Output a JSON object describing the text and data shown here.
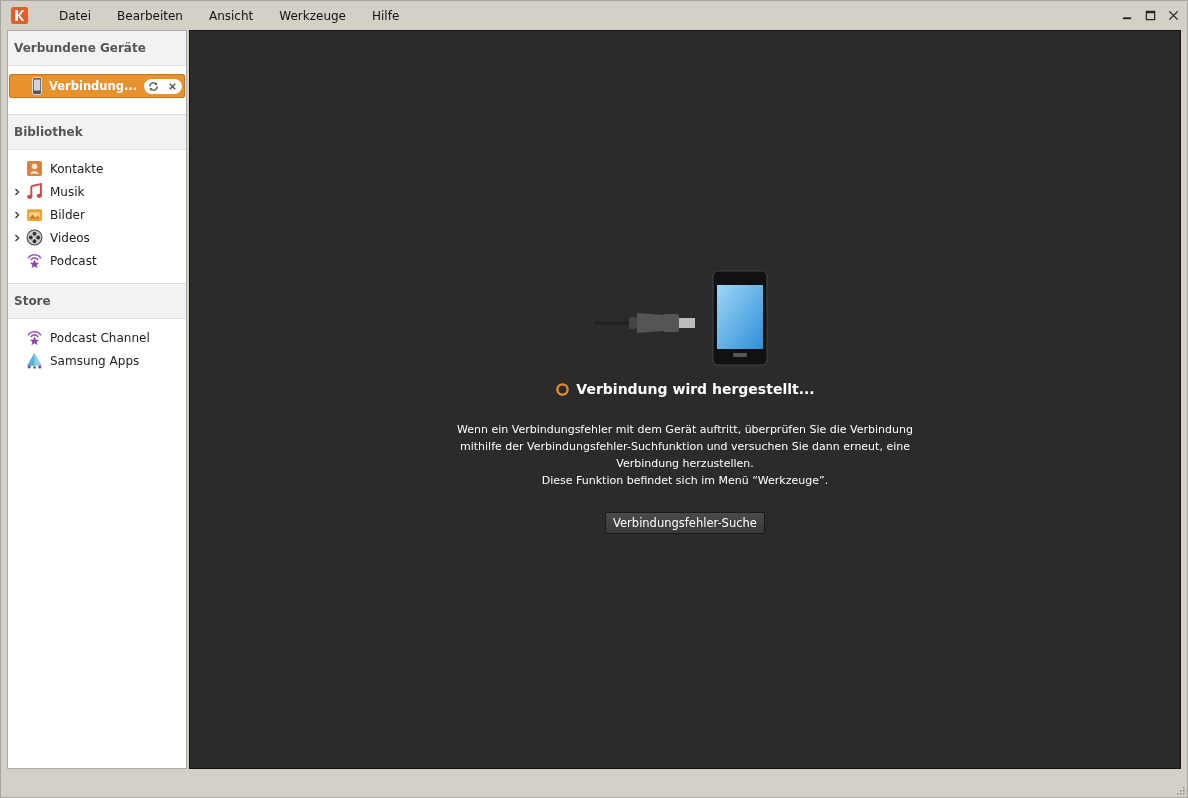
{
  "menu": [
    "Datei",
    "Bearbeiten",
    "Ansicht",
    "Werkzeuge",
    "Hilfe"
  ],
  "sidebar": {
    "sections": [
      {
        "title": "Verbundene Geräte",
        "kind": "devices",
        "items": [
          {
            "label": "Verbindung...",
            "selected": true,
            "kind": "phone"
          }
        ]
      },
      {
        "title": "Bibliothek",
        "kind": "library",
        "items": [
          {
            "label": "Kontakte",
            "kind": "contacts"
          },
          {
            "label": "Musik",
            "kind": "music",
            "expanded": false
          },
          {
            "label": "Bilder",
            "kind": "pictures",
            "expanded": false
          },
          {
            "label": "Videos",
            "kind": "videos",
            "expanded": false
          },
          {
            "label": "Podcast",
            "kind": "podcast"
          }
        ]
      },
      {
        "title": "Store",
        "kind": "library",
        "items": [
          {
            "label": "Podcast Channel",
            "kind": "podcast"
          },
          {
            "label": "Samsung Apps",
            "kind": "apps"
          }
        ]
      }
    ]
  },
  "main": {
    "status": "Verbindung wird hergestellt...",
    "description_lines": [
      "Wenn ein Verbindungsfehler mit dem Gerät auftritt, überprüfen Sie die Verbindung",
      "mithilfe der Verbindungsfehler-Suchfunktion und versuchen Sie dann erneut, eine",
      "Verbindung herzustellen.",
      "Diese Funktion befindet sich im Menü “Werkzeuge”."
    ],
    "button": "Verbindungsfehler-Suche"
  }
}
